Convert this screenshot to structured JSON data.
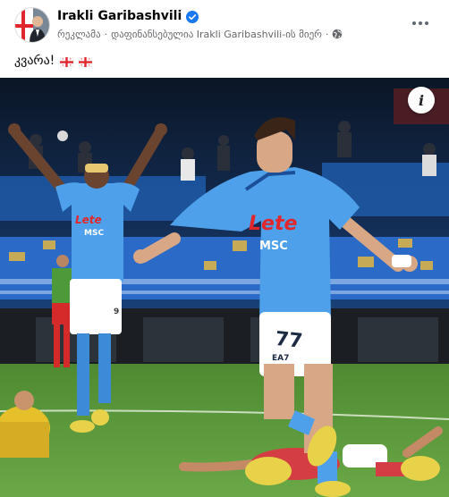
{
  "post": {
    "author": "Irakli Garibashvili",
    "meta": {
      "sponsored": "რეკლამა",
      "separator": "·",
      "paid_by": "დაფინანსებულია Irakli Garibashvili-ის მიერ",
      "privacy_icon": "globe-icon"
    },
    "caption": "კვარა!",
    "flags": [
      "georgia-flag",
      "georgia-flag"
    ]
  },
  "photo": {
    "left_shirt_sponsor": "Lete",
    "left_shirt_sub": "MSC",
    "right_shirt_sponsor": "Lete",
    "right_shirt_sub": "MSC",
    "shorts_number": "77",
    "shirt_number_left": "9",
    "shorts_brand": "EA7"
  },
  "icons": {
    "verified": "verified-badge-icon",
    "more": "more-options-icon",
    "info": "info-icon"
  },
  "colors": {
    "napoli_blue": "#3a8fe0",
    "verified_blue": "#1877f2",
    "pitch_green": "#5f9a3c",
    "text_secondary": "#65676b"
  }
}
